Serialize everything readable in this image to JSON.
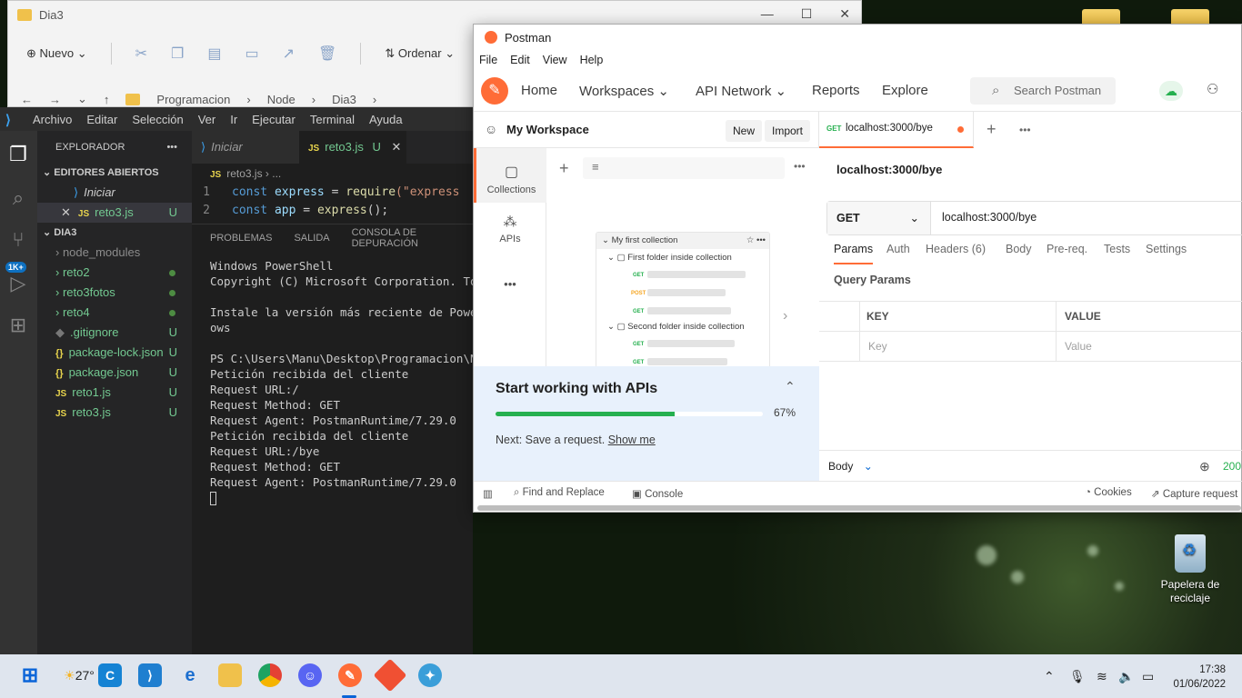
{
  "explorer": {
    "title": "Dia3",
    "nuevo": "Nuevo",
    "ordenar": "Ordenar",
    "path": [
      "Programacion",
      "Node",
      "Dia3"
    ]
  },
  "vscode": {
    "menu": [
      "Archivo",
      "Editar",
      "Selección",
      "Ver",
      "Ir",
      "Ejecutar",
      "Terminal",
      "Ayuda"
    ],
    "explorer_title": "EXPLORADOR",
    "open_editors_title": "EDITORES ABIERTOS",
    "open_editors": [
      {
        "name": "Iniciar",
        "status": ""
      },
      {
        "name": "reto3.js",
        "status": "U"
      }
    ],
    "folder_title": "DIA3",
    "files": [
      {
        "name": "node_modules",
        "type": "folder",
        "status": ""
      },
      {
        "name": "reto2",
        "type": "folder",
        "status": "dot"
      },
      {
        "name": "reto3fotos",
        "type": "folder",
        "status": "dot"
      },
      {
        "name": "reto4",
        "type": "folder",
        "status": "dot"
      },
      {
        "name": ".gitignore",
        "type": "git",
        "status": "U"
      },
      {
        "name": "package-lock.json",
        "type": "json",
        "status": "U"
      },
      {
        "name": "package.json",
        "type": "json",
        "status": "U"
      },
      {
        "name": "reto1.js",
        "type": "js",
        "status": "U"
      },
      {
        "name": "reto3.js",
        "type": "js",
        "status": "U"
      }
    ],
    "badge": "1K+",
    "tabs": [
      {
        "label": "Iniciar"
      },
      {
        "label": "reto3.js",
        "status": "U"
      }
    ],
    "breadcrumb": "reto3.js › ...",
    "code": [
      {
        "num": "1",
        "kw": "const",
        "id": "express",
        "op": " = ",
        "fn": "require",
        "rest": "(\"express"
      },
      {
        "num": "2",
        "kw": "const",
        "id": "app",
        "op": "  = ",
        "fn": "express",
        "rest": "();"
      }
    ],
    "panel_tabs": [
      "PROBLEMAS",
      "SALIDA",
      "CONSOLA DE DEPURACIÓN"
    ],
    "terminal": [
      "Windows PowerShell",
      "Copyright (C) Microsoft Corporation. Todos",
      "",
      "Instale la versión más reciente de PowerSh",
      "ows",
      "",
      "PS C:\\Users\\Manu\\Desktop\\Programacion\\Node",
      "Petición recibida del cliente",
      "Request URL:/",
      "Request Method: GET",
      "Request Agent: PostmanRuntime/7.29.0",
      "Petición recibida del cliente",
      "Request URL:/bye",
      "Request Method: GET",
      "Request Agent: PostmanRuntime/7.29.0"
    ]
  },
  "postman": {
    "title": "Postman",
    "menu": [
      "File",
      "Edit",
      "View",
      "Help"
    ],
    "nav": {
      "home": "Home",
      "workspaces": "Workspaces",
      "api_network": "API Network",
      "reports": "Reports",
      "explore": "Explore"
    },
    "search_placeholder": "Search Postman",
    "workspace": "My Workspace",
    "new_btn": "New",
    "import_btn": "Import",
    "left_nav": {
      "collections": "Collections",
      "apis": "APIs",
      "more": "•••"
    },
    "preview": {
      "collection": "My first collection",
      "folder1": "First folder inside collection",
      "folder2": "Second folder inside collection",
      "methods": [
        "GET",
        "POST",
        "GET",
        "GET",
        "GET"
      ]
    },
    "start": {
      "title": "Start working with APIs",
      "progress": 67,
      "progress_label": "67%",
      "next_text": "Next: Save a request.",
      "show_me": "Show me",
      "accent": "#26b04f"
    },
    "tab": {
      "method": "GET",
      "label": "localhost:3000/bye"
    },
    "request_title": "localhost:3000/bye",
    "method": "GET",
    "url": "localhost:3000/bye",
    "req_tabs": [
      "Params",
      "Auth",
      "Headers (6)",
      "Body",
      "Pre-req.",
      "Tests",
      "Settings"
    ],
    "query_params": "Query Params",
    "table_headers": [
      "KEY",
      "VALUE"
    ],
    "key_placeholder": "Key",
    "value_placeholder": "Value",
    "response_label": "Body",
    "response_status": "200",
    "status_bar": {
      "find": "Find and Replace",
      "console": "Console",
      "cookies": "Cookies",
      "capture": "Capture request"
    },
    "brand_color": "#ff6c37"
  },
  "desktop": {
    "recycle_bin": "Papelera de reciclaje"
  },
  "taskbar": {
    "weather": "27°",
    "time": "17:38",
    "date": "01/06/2022"
  }
}
